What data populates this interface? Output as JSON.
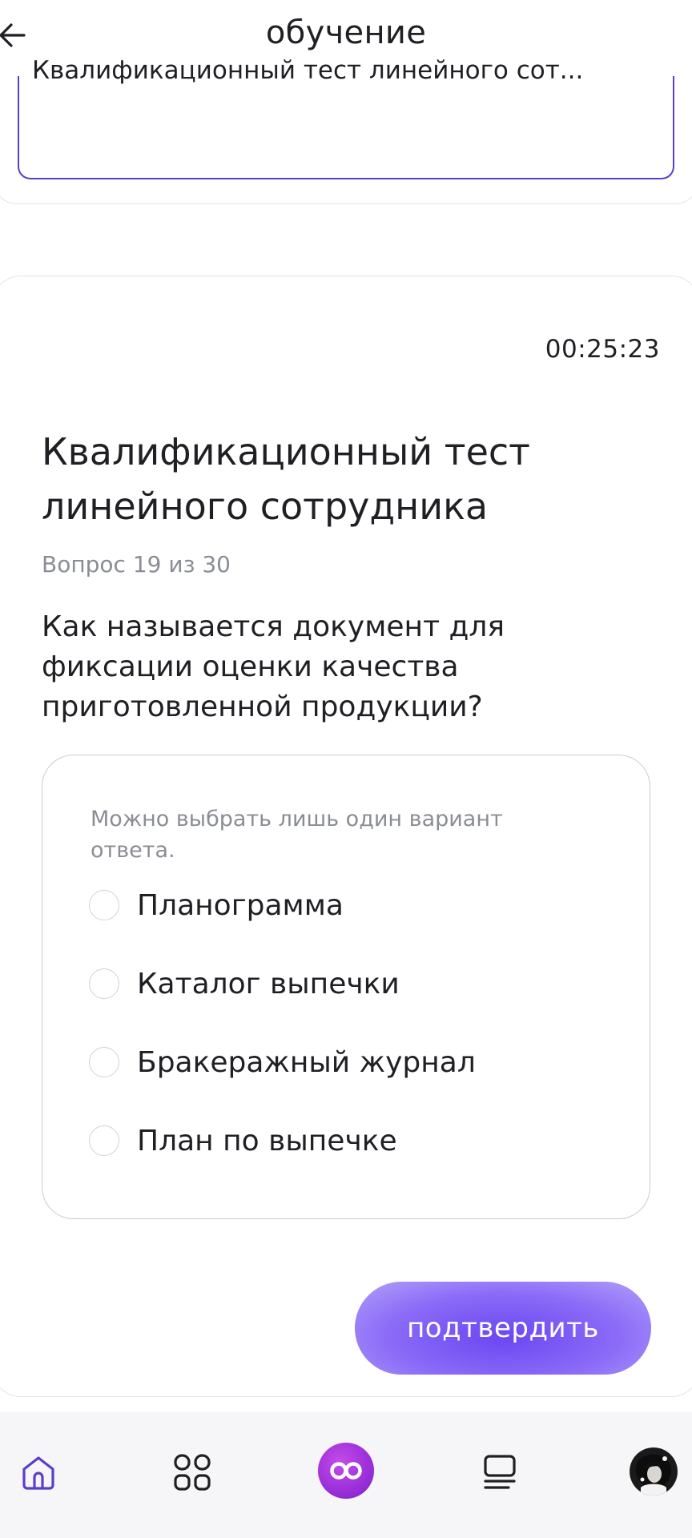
{
  "header": {
    "title": "обучение"
  },
  "course_select": {
    "value": "Квалификационный тест линейного сот..."
  },
  "quiz": {
    "timer": "00:25:23",
    "title": "Квалификационный тест линейного сотрудника",
    "counter": "Вопрос 19 из 30",
    "question": "Как называется документ для фиксации оценки качества приготовленной продукции?",
    "hint": "Можно выбрать лишь один вариант ответа.",
    "options": [
      {
        "label": "Планограмма"
      },
      {
        "label": "Каталог выпечки"
      },
      {
        "label": "Бракеражный журнал"
      },
      {
        "label": "План по выпечке"
      }
    ],
    "confirm_label": "подтвердить"
  },
  "bottom_nav": {
    "items": [
      "home-icon",
      "apps-grid-icon",
      "infinity-icon",
      "courses-list-icon",
      "avatar"
    ]
  },
  "colors": {
    "accent": "#6a47f2",
    "brand_center": "#9a2fd9",
    "select_border": "#5b3ec9",
    "muted_text": "#8a8d94"
  }
}
